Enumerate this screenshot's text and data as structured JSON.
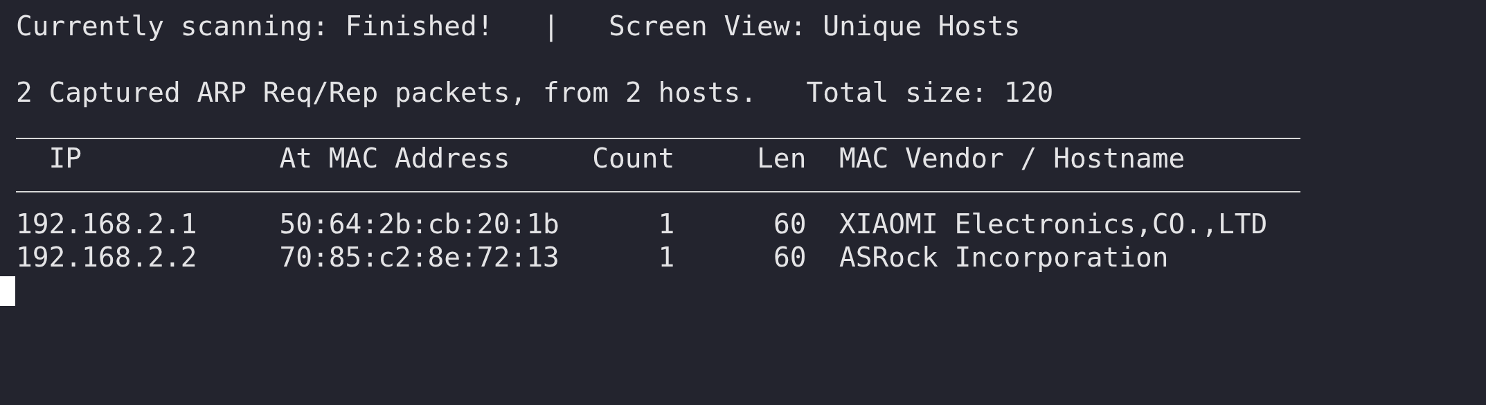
{
  "status_line": {
    "scanning": "Currently scanning: Finished!",
    "separator": "|",
    "view": "Screen View: Unique Hosts"
  },
  "summary_line": {
    "captured": "2 Captured ARP Req/Rep packets, from 2 hosts.",
    "total": "Total size: 120"
  },
  "table": {
    "columns": [
      "IP",
      "At MAC Address",
      "Count",
      "Len",
      "MAC Vendor / Hostname"
    ],
    "rows": [
      {
        "cells": [
          "192.168.2.1",
          "50:64:2b:cb:20:1b",
          "1",
          "60",
          "XIAOMI Electronics,CO.,LTD"
        ]
      },
      {
        "cells": [
          "192.168.2.2",
          "70:85:c2:8e:72:13",
          "1",
          "60",
          "ASRock Incorporation"
        ]
      }
    ]
  }
}
